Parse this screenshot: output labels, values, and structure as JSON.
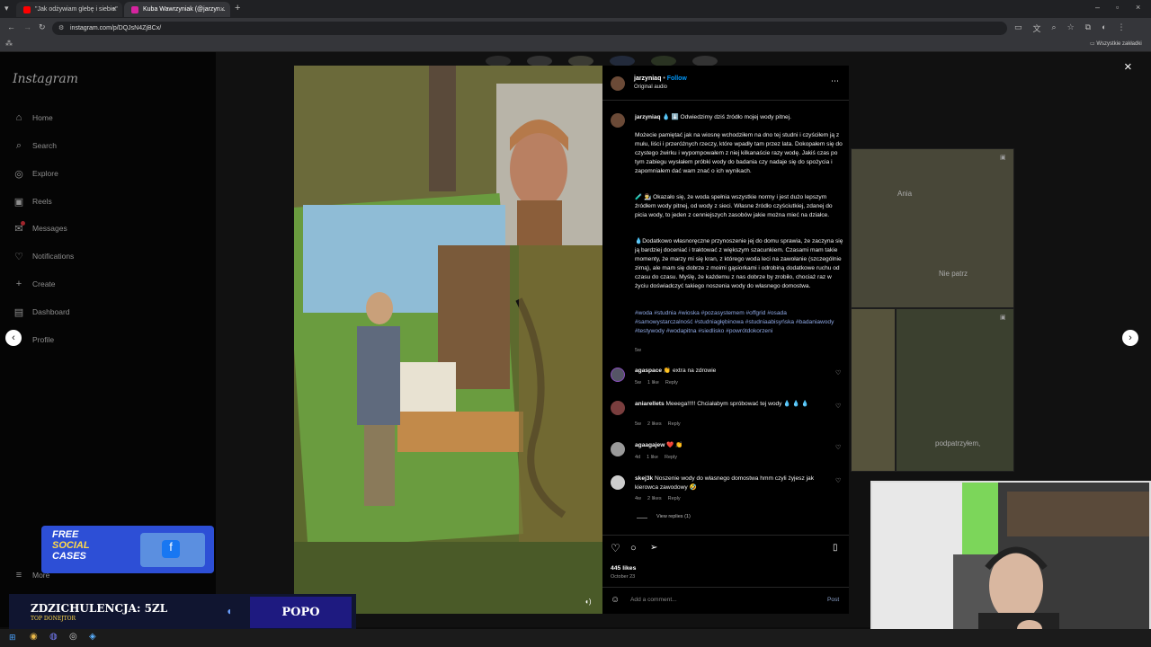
{
  "browser": {
    "tabs": [
      {
        "label": "\"Jak odżywiam glebę i siebie\"",
        "color": "#ff0000"
      },
      {
        "label": "Kuba Wawrzyniak (@jarzyn...",
        "color": "#d6249f"
      }
    ],
    "url": "instagram.com/p/DQJsN4ZjBCx/",
    "bookmarks_label": "Wszystkie zakładki"
  },
  "sidebar": {
    "logo": "Instagram",
    "items": [
      {
        "label": "Home",
        "icon": "home-icon",
        "glyph": "⌂"
      },
      {
        "label": "Search",
        "icon": "search-icon",
        "glyph": "⌕"
      },
      {
        "label": "Explore",
        "icon": "compass-icon",
        "glyph": "◎"
      },
      {
        "label": "Reels",
        "icon": "reels-icon",
        "glyph": "▣"
      },
      {
        "label": "Messages",
        "icon": "messenger-icon",
        "glyph": "✉"
      },
      {
        "label": "Notifications",
        "icon": "heart-icon",
        "glyph": "♡"
      },
      {
        "label": "Create",
        "icon": "plus-icon",
        "glyph": "+"
      },
      {
        "label": "Dashboard",
        "icon": "dashboard-icon",
        "glyph": "▤"
      },
      {
        "label": "Profile",
        "icon": "profile-icon",
        "glyph": "●"
      }
    ],
    "more_label": "More"
  },
  "post": {
    "username": "jarzyniaq",
    "follow_label": "Follow",
    "audio": "Original audio",
    "caption": {
      "intro": "💧 ⬇️ Odwiedzimy dziś źródło mojej wody pitnej.",
      "p1": "Możecie pamiętać jak na wiosnę wchodziłem na dno tej studni i czyściłem ją z mułu, liści i przeróżnych rzeczy, które wpadły tam przez lata. Dokopałem się do czystego żwirku i wypompowałem z niej kilkanaście razy wodę. Jakiś czas po tym zabiegu wysłałem próbki wody do badania czy nadaje się do spożycia i zapomniałem dać wam znać o ich wynikach.",
      "p2": "🧪 👨‍🔬 Okazało się, że woda spełnia wszystkie normy i jest dużo lepszym źródłem wody pitnej, od wody z sieci. Własne źródło czyściutkiej, zdanej do picia wody, to jeden z cenniejszych zasobów jakie można mieć na działce.",
      "p3": "💧Dodatkowo własnoręczne przynoszenie jej do domu sprawia, że zaczyna się ją bardziej doceniać i traktować z większym szacunkiem. Czasami mam takie momenty, że marzy mi się kran, z którego woda leci na zawołanie (szczególnie zimą), ale mam się dobrze z moimi gąsiorkami i odrobiną dodatkowe ruchu od czasu do czasu. Myślę, że każdemu z nas dobrze by zrobiło, chociaż raz w życiu doświadczyć takiego noszenia wody do własnego domostwa.",
      "hashtags": "#woda #studnia #wioska #pozasystemem #offgrid #osada #samowystarczalność #studniagłębinowa #studniaabisyńska #badaniawody #testywody #wodapitna #siedlisko #powrótdokorzeni",
      "age": "5w"
    },
    "comments": [
      {
        "user": "agaspace",
        "text": "👏 extra na zdrowie",
        "meta": [
          "5w",
          "1 like",
          "Reply"
        ]
      },
      {
        "user": "aniarellets",
        "text": "Meeega!!!!! Chciałabym spróbować tej wody 💧 💧 💧",
        "meta": [
          "5w",
          "2 likes",
          "Reply"
        ]
      },
      {
        "user": "agaagajew",
        "text": "❤️ 👏",
        "meta": [
          "4d",
          "1 like",
          "Reply"
        ]
      },
      {
        "user": "skej3k",
        "text": "Noszenie wody do własnego domostwa hmm czyli żyjesz jak kierowca zawodowy 🤣",
        "meta": [
          "4w",
          "2 likes",
          "Reply"
        ]
      }
    ],
    "view_replies": "View replies (1)",
    "likes": "445 likes",
    "date": "October 23",
    "comment_placeholder": "Add a comment...",
    "post_label": "Post"
  },
  "background_overlay_texts": [
    "Ania",
    "Nie patrz",
    "podpatrzyłem,"
  ],
  "promo": {
    "line1": "FREE",
    "line2": "SOCIAL",
    "line3": "CASES"
  },
  "donation": {
    "label": "ZDZICHULENCJA: 5ZL",
    "sub": "TOP DONEJTOR",
    "name": "POPO"
  },
  "colors": {
    "accent": "#0095f6",
    "hashtag": "#8fa9e6",
    "background": "#0c0c0c"
  }
}
